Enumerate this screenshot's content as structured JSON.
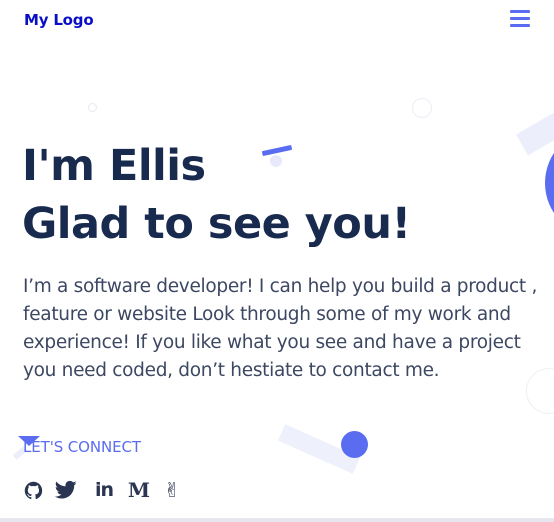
{
  "header": {
    "logo_text": "My Logo",
    "menu_icon": "hamburger-menu-icon"
  },
  "hero": {
    "title_line_1": "I'm Ellis",
    "title_line_2": "Glad to see you!",
    "description": "I’m a software developer! I can help you build a product , feature or website Look through some of my work and experience! If you like what you see and have a project you need coded, don’t hestiate to contact me.",
    "cta_label": "LET'S CONNECT"
  },
  "social_links": [
    {
      "name": "github",
      "icon": "github-icon"
    },
    {
      "name": "twitter",
      "icon": "twitter-icon"
    },
    {
      "name": "linkedin",
      "icon": "linkedin-icon",
      "glyph": "in"
    },
    {
      "name": "medium",
      "icon": "medium-icon",
      "glyph": "M"
    },
    {
      "name": "angellist",
      "icon": "angellist-icon",
      "glyph": "✌"
    }
  ],
  "colors": {
    "brand": "#0a0fc7",
    "accent": "#5a6cf0",
    "heading": "#192a4f",
    "body_text": "#3c4762",
    "icon": "#2a3552"
  }
}
